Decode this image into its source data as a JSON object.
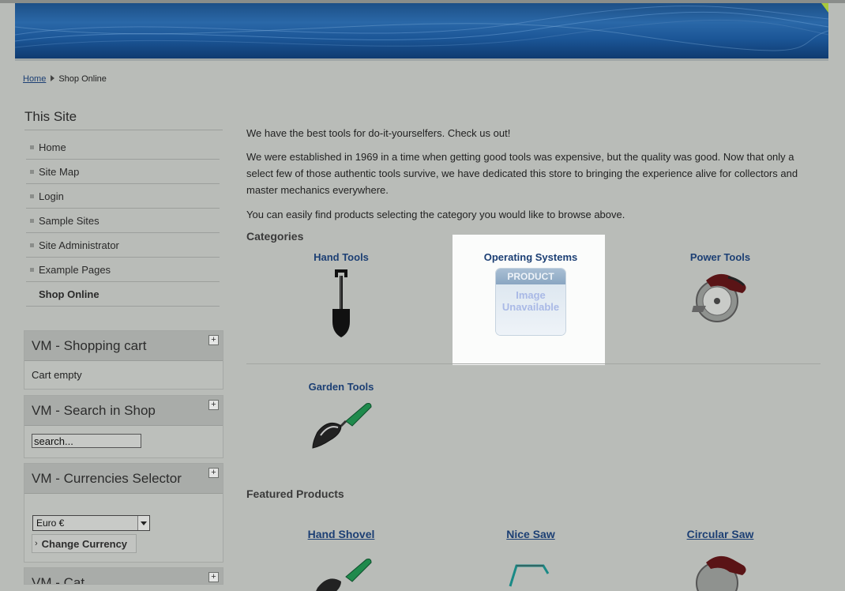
{
  "breadcrumb": {
    "home": "Home",
    "current": "Shop Online"
  },
  "sidebar": {
    "title": "This Site",
    "menu": [
      "Home",
      "Site Map",
      "Login",
      "Sample Sites",
      "Site Administrator",
      "Example Pages",
      "Shop Online"
    ],
    "active_index": 6
  },
  "modules": {
    "cart": {
      "title": "VM - Shopping cart",
      "toggle": "+",
      "status": "Cart empty"
    },
    "search": {
      "title": "VM - Search in Shop",
      "toggle": "+",
      "value": "search..."
    },
    "currency": {
      "title": "VM - Currencies Selector",
      "toggle": "+",
      "selected": "Euro €",
      "button": "Change Currency"
    },
    "next": {
      "title": "VM - Cat",
      "toggle": "+"
    }
  },
  "main": {
    "intro": [
      "We have the best tools for do-it-yourselfers. Check us out!",
      "We were established in 1969 in a time when getting good tools was expensive, but the quality was good. Now that only a select few of those authentic tools survive, we have dedicated this store to bringing the experience alive for collectors and master mechanics everywhere.",
      "You can easily find products selecting the category you would like to browse above."
    ],
    "categories_heading": "Categories",
    "categories": [
      {
        "name": "Hand Tools",
        "icon": "shovel-icon"
      },
      {
        "name": "Operating Systems",
        "icon": "product-image-unavailable-icon"
      },
      {
        "name": "Power Tools",
        "icon": "circular-saw-icon"
      },
      {
        "name": "Garden Tools",
        "icon": "trowel-icon"
      }
    ],
    "placeholder_image": {
      "line1": "PRODUCT",
      "line2": "Image",
      "line3": "Unavailable"
    },
    "featured_heading": "Featured Products",
    "featured": [
      {
        "name": "Hand Shovel",
        "icon": "trowel-icon"
      },
      {
        "name": "Nice Saw",
        "icon": "hacksaw-icon"
      },
      {
        "name": "Circular Saw",
        "icon": "circular-saw-icon"
      }
    ]
  },
  "colors": {
    "background": "#b9bcb8",
    "link": "#1c3f74",
    "banner": "#1d4f86",
    "highlight": "#fbfcfb"
  }
}
